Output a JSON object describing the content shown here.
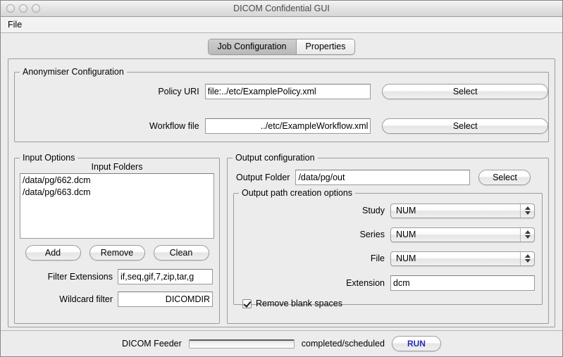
{
  "window": {
    "title": "DICOM Confidential GUI",
    "traffic_lights": [
      "close",
      "minimize",
      "zoom"
    ]
  },
  "menubar": {
    "items": [
      {
        "label": "File"
      }
    ]
  },
  "tabs": [
    {
      "label": "Job Configuration",
      "selected": true
    },
    {
      "label": "Properties",
      "selected": false
    }
  ],
  "anonymiser": {
    "title": "Anonymiser Configuration",
    "policy": {
      "label": "Policy URI",
      "value": "file:../etc/ExamplePolicy.xml",
      "button": "Select"
    },
    "workflow": {
      "label": "Workflow file",
      "value": "../etc/ExampleWorkflow.xml",
      "button": "Select"
    }
  },
  "input_options": {
    "title": "Input Options",
    "list_label": "Input Folders",
    "folders": [
      "/data/pg/662.dcm",
      "/data/pg/663.dcm"
    ],
    "buttons": [
      {
        "label": "Add"
      },
      {
        "label": "Remove"
      },
      {
        "label": "Clean"
      }
    ],
    "filter_extensions": {
      "label": "Filter Extensions",
      "value": "if,seq,gif,7,zip,tar,g"
    },
    "wildcard_filter": {
      "label": "Wildcard filter",
      "value": "DICOMDIR"
    }
  },
  "output_configuration": {
    "title": "Output configuration",
    "output_folder": {
      "label": "Output Folder",
      "value": "/data/pg/out",
      "button": "Select"
    },
    "path_options": {
      "title": "Output path creation options",
      "selects": [
        {
          "label": "Study",
          "value": "NUM"
        },
        {
          "label": "Series",
          "value": "NUM"
        },
        {
          "label": "File",
          "value": "NUM"
        }
      ],
      "extension": {
        "label": "Extension",
        "value": "dcm"
      },
      "remove_blank_spaces": {
        "label": "Remove blank spaces",
        "checked": true
      }
    }
  },
  "statusbar": {
    "feeder_label": "DICOM Feeder",
    "progress_percent": 0,
    "completed_label": "completed/scheduled",
    "run_button": "RUN"
  },
  "colors": {
    "window_background": "#ececec",
    "field_background": "#ffffff",
    "border": "#9b9b9b",
    "run_text": "#2b2bbb",
    "title_text": "#4a4a4a"
  }
}
